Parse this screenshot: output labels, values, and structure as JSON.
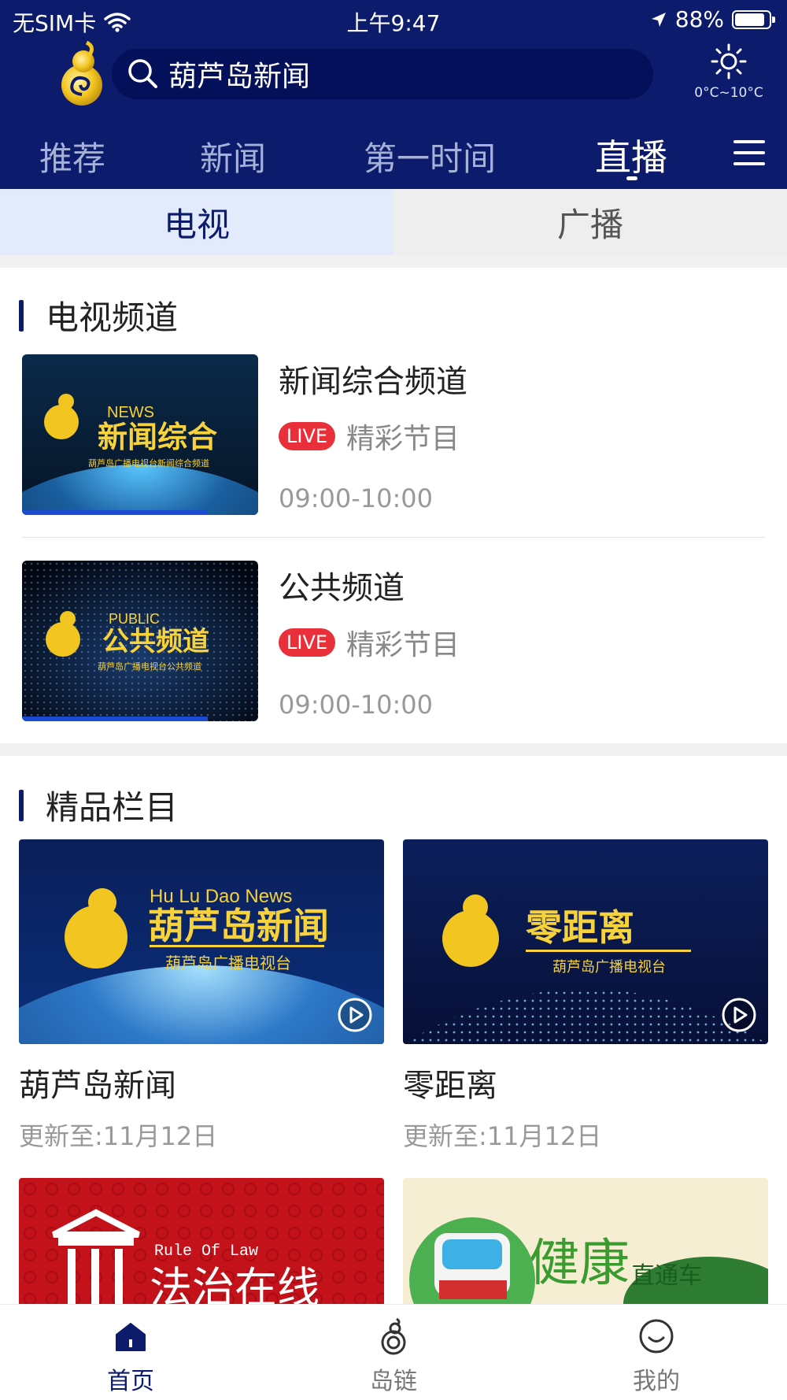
{
  "status_bar": {
    "carrier": "无SIM卡",
    "time": "上午9:47",
    "battery": "88%",
    "battery_level": 0.88
  },
  "header": {
    "search_text": "葫芦岛新闻",
    "weather": "0°C~10°C",
    "tabs": [
      {
        "label": "推荐",
        "active": false
      },
      {
        "label": "新闻",
        "active": false
      },
      {
        "label": "第一时间",
        "active": false
      },
      {
        "label": "直播",
        "active": true
      }
    ]
  },
  "subtabs": [
    {
      "label": "电视",
      "active": true
    },
    {
      "label": "广播",
      "active": false
    }
  ],
  "tv_section": {
    "title": "电视频道",
    "channels": [
      {
        "name": "新闻综合频道",
        "live_badge": "LIVE",
        "program": "精彩节目",
        "time": "09:00-10:00",
        "thumb_en": "NEWS",
        "thumb_cn": "新闻综合",
        "thumb_sub": "葫芦岛广播电视台新闻综合频道"
      },
      {
        "name": "公共频道",
        "live_badge": "LIVE",
        "program": "精彩节目",
        "time": "09:00-10:00",
        "thumb_en": "PUBLIC",
        "thumb_cn": "公共频道",
        "thumb_sub": "葫芦岛广播电视台公共频道"
      }
    ]
  },
  "featured_section": {
    "title": "精品栏目",
    "programs": [
      {
        "title": "葫芦岛新闻",
        "updated": "更新至:11月12日",
        "thumb_en": "Hu  Lu  Dao News",
        "thumb_cn": "葫芦岛新闻",
        "thumb_sub": "葫芦岛广播电视台"
      },
      {
        "title": "零距离",
        "updated": "更新至:11月12日",
        "thumb_cn": "零距离",
        "thumb_sub": "葫芦岛广播电视台"
      }
    ],
    "partial": [
      {
        "thumb_en": "Rule Of Law",
        "thumb_cn": "法治在线"
      },
      {
        "thumb_cn": "健康",
        "thumb_cn2": "直通车"
      }
    ]
  },
  "bottom_nav": [
    {
      "label": "首页",
      "icon": "home-icon",
      "active": true
    },
    {
      "label": "岛链",
      "icon": "swirl-logo-icon",
      "active": false
    },
    {
      "label": "我的",
      "icon": "smile-icon",
      "active": false
    }
  ],
  "colors": {
    "primary": "#0c1b6b",
    "live": "#e9303a",
    "subtab_active_bg": "#e2eafc"
  }
}
